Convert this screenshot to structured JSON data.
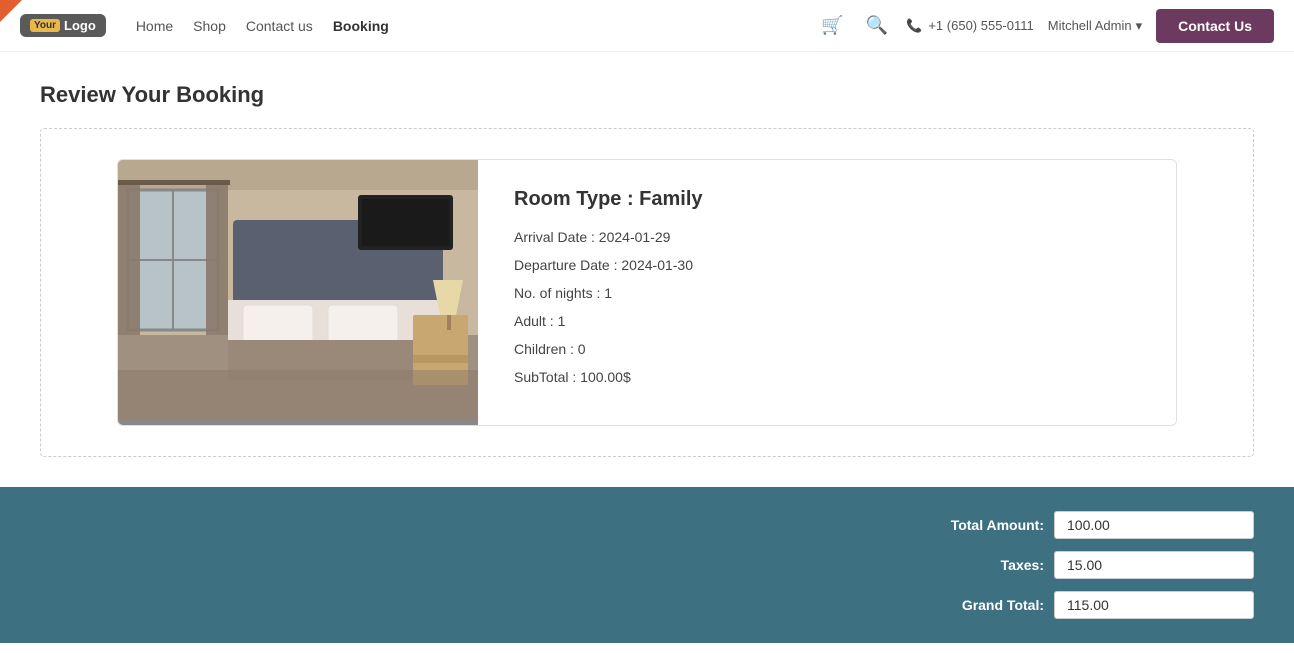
{
  "navbar": {
    "logo_text": "YourLogo",
    "nav_links": [
      {
        "label": "Home",
        "active": false
      },
      {
        "label": "Shop",
        "active": false
      },
      {
        "label": "Contact us",
        "active": false
      },
      {
        "label": "Booking",
        "active": true
      }
    ],
    "phone": "+1 (650) 555-0111",
    "user": "Mitchell Admin",
    "contact_btn": "Contact Us"
  },
  "page": {
    "title": "Review Your Booking"
  },
  "booking": {
    "room_type_label": "Room Type : Family",
    "arrival_label": "Arrival Date : 2024-01-29",
    "departure_label": "Departure Date : 2024-01-30",
    "nights_label": "No. of nights : 1",
    "adult_label": "Adult : 1",
    "children_label": "Children : 0",
    "subtotal_label": "SubTotal : 100.00$"
  },
  "totals": {
    "total_amount_label": "Total Amount:",
    "total_amount_value": "100.00",
    "taxes_label": "Taxes:",
    "taxes_value": "15.00",
    "grand_total_label": "Grand Total:",
    "grand_total_value": "115.00"
  }
}
